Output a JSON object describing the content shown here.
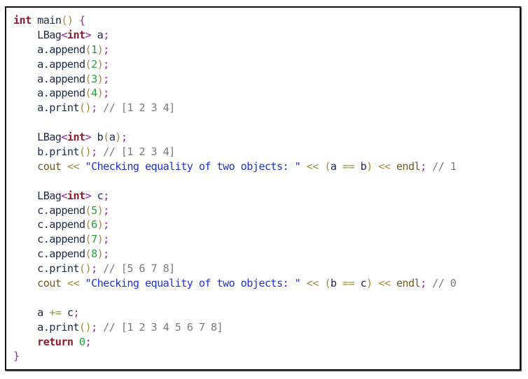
{
  "code": {
    "language": "cpp",
    "lines": [
      [
        {
          "t": "int",
          "c": "kw"
        },
        {
          "t": " main",
          "c": "plain"
        },
        {
          "t": "()",
          "c": "punc"
        },
        {
          "t": " {",
          "c": "brace"
        }
      ],
      [
        {
          "t": "    LBag",
          "c": "plain"
        },
        {
          "t": "<",
          "c": "ang"
        },
        {
          "t": "int",
          "c": "kw"
        },
        {
          "t": ">",
          "c": "ang"
        },
        {
          "t": " a",
          "c": "plain"
        },
        {
          "t": ";",
          "c": "semi"
        }
      ],
      [
        {
          "t": "    a.append",
          "c": "plain"
        },
        {
          "t": "(",
          "c": "punc"
        },
        {
          "t": "1",
          "c": "num"
        },
        {
          "t": ")",
          "c": "punc"
        },
        {
          "t": ";",
          "c": "semi"
        }
      ],
      [
        {
          "t": "    a.append",
          "c": "plain"
        },
        {
          "t": "(",
          "c": "punc"
        },
        {
          "t": "2",
          "c": "num"
        },
        {
          "t": ")",
          "c": "punc"
        },
        {
          "t": ";",
          "c": "semi"
        }
      ],
      [
        {
          "t": "    a.append",
          "c": "plain"
        },
        {
          "t": "(",
          "c": "punc"
        },
        {
          "t": "3",
          "c": "num"
        },
        {
          "t": ")",
          "c": "punc"
        },
        {
          "t": ";",
          "c": "semi"
        }
      ],
      [
        {
          "t": "    a.append",
          "c": "plain"
        },
        {
          "t": "(",
          "c": "punc"
        },
        {
          "t": "4",
          "c": "num"
        },
        {
          "t": ")",
          "c": "punc"
        },
        {
          "t": ";",
          "c": "semi"
        }
      ],
      [
        {
          "t": "    a.print",
          "c": "plain"
        },
        {
          "t": "()",
          "c": "punc"
        },
        {
          "t": ";",
          "c": "semi"
        },
        {
          "t": " // [1 2 3 4]",
          "c": "cmt"
        }
      ],
      [],
      [
        {
          "t": "    LBag",
          "c": "plain"
        },
        {
          "t": "<",
          "c": "ang"
        },
        {
          "t": "int",
          "c": "kw"
        },
        {
          "t": ">",
          "c": "ang"
        },
        {
          "t": " b",
          "c": "plain"
        },
        {
          "t": "(",
          "c": "punc"
        },
        {
          "t": "a",
          "c": "plain"
        },
        {
          "t": ")",
          "c": "punc"
        },
        {
          "t": ";",
          "c": "semi"
        }
      ],
      [
        {
          "t": "    b.print",
          "c": "plain"
        },
        {
          "t": "()",
          "c": "punc"
        },
        {
          "t": ";",
          "c": "semi"
        },
        {
          "t": " // [1 2 3 4]",
          "c": "cmt"
        }
      ],
      [
        {
          "t": "    cout",
          "c": "io"
        },
        {
          "t": " << ",
          "c": "op"
        },
        {
          "t": "\"Checking equality of two objects: \"",
          "c": "str"
        },
        {
          "t": " << ",
          "c": "op"
        },
        {
          "t": "(",
          "c": "punc"
        },
        {
          "t": "a",
          "c": "plain"
        },
        {
          "t": " == ",
          "c": "op"
        },
        {
          "t": "b",
          "c": "plain"
        },
        {
          "t": ")",
          "c": "punc"
        },
        {
          "t": " << ",
          "c": "op"
        },
        {
          "t": "endl",
          "c": "io"
        },
        {
          "t": ";",
          "c": "semi"
        },
        {
          "t": " // 1",
          "c": "cmt"
        }
      ],
      [],
      [
        {
          "t": "    LBag",
          "c": "plain"
        },
        {
          "t": "<",
          "c": "ang"
        },
        {
          "t": "int",
          "c": "kw"
        },
        {
          "t": ">",
          "c": "ang"
        },
        {
          "t": " c",
          "c": "plain"
        },
        {
          "t": ";",
          "c": "semi"
        }
      ],
      [
        {
          "t": "    c.append",
          "c": "plain"
        },
        {
          "t": "(",
          "c": "punc"
        },
        {
          "t": "5",
          "c": "num"
        },
        {
          "t": ")",
          "c": "punc"
        },
        {
          "t": ";",
          "c": "semi"
        }
      ],
      [
        {
          "t": "    c.append",
          "c": "plain"
        },
        {
          "t": "(",
          "c": "punc"
        },
        {
          "t": "6",
          "c": "num"
        },
        {
          "t": ")",
          "c": "punc"
        },
        {
          "t": ";",
          "c": "semi"
        }
      ],
      [
        {
          "t": "    c.append",
          "c": "plain"
        },
        {
          "t": "(",
          "c": "punc"
        },
        {
          "t": "7",
          "c": "num"
        },
        {
          "t": ")",
          "c": "punc"
        },
        {
          "t": ";",
          "c": "semi"
        }
      ],
      [
        {
          "t": "    c.append",
          "c": "plain"
        },
        {
          "t": "(",
          "c": "punc"
        },
        {
          "t": "8",
          "c": "num"
        },
        {
          "t": ")",
          "c": "punc"
        },
        {
          "t": ";",
          "c": "semi"
        }
      ],
      [
        {
          "t": "    c.print",
          "c": "plain"
        },
        {
          "t": "()",
          "c": "punc"
        },
        {
          "t": ";",
          "c": "semi"
        },
        {
          "t": " // [5 6 7 8]",
          "c": "cmt"
        }
      ],
      [
        {
          "t": "    cout",
          "c": "io"
        },
        {
          "t": " << ",
          "c": "op"
        },
        {
          "t": "\"Checking equality of two objects: \"",
          "c": "str"
        },
        {
          "t": " << ",
          "c": "op"
        },
        {
          "t": "(",
          "c": "punc"
        },
        {
          "t": "b",
          "c": "plain"
        },
        {
          "t": " == ",
          "c": "op"
        },
        {
          "t": "c",
          "c": "plain"
        },
        {
          "t": ")",
          "c": "punc"
        },
        {
          "t": " << ",
          "c": "op"
        },
        {
          "t": "endl",
          "c": "io"
        },
        {
          "t": ";",
          "c": "semi"
        },
        {
          "t": " // 0",
          "c": "cmt"
        }
      ],
      [],
      [
        {
          "t": "    a",
          "c": "plain"
        },
        {
          "t": " += ",
          "c": "op"
        },
        {
          "t": "c",
          "c": "plain"
        },
        {
          "t": ";",
          "c": "semi"
        }
      ],
      [
        {
          "t": "    a.print",
          "c": "plain"
        },
        {
          "t": "()",
          "c": "punc"
        },
        {
          "t": ";",
          "c": "semi"
        },
        {
          "t": " // [1 2 3 4 5 6 7 8]",
          "c": "cmt"
        }
      ],
      [
        {
          "t": "    return",
          "c": "kw"
        },
        {
          "t": " ",
          "c": "plain"
        },
        {
          "t": "0",
          "c": "num"
        },
        {
          "t": ";",
          "c": "semi"
        }
      ],
      [
        {
          "t": "}",
          "c": "brace"
        }
      ]
    ]
  }
}
